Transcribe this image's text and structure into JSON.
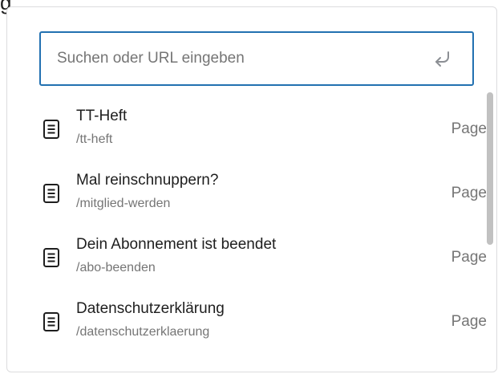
{
  "page_fragment_text": "g",
  "search": {
    "placeholder": "Suchen oder URL eingeben",
    "value": "",
    "submit_icon": "enter-return-icon"
  },
  "results": [
    {
      "title": "TT-Heft",
      "url": "/tt-heft",
      "type": "Page",
      "icon": "document-page-icon"
    },
    {
      "title": "Mal reinschnuppern?",
      "url": "/mitglied-werden",
      "type": "Page",
      "icon": "document-page-icon"
    },
    {
      "title": "Dein Abonnement ist beendet",
      "url": "/abo-beenden",
      "type": "Page",
      "icon": "document-page-icon"
    },
    {
      "title": "Datenschutzerklärung",
      "url": "/datenschutzerklaerung",
      "type": "Page",
      "icon": "document-page-icon"
    }
  ],
  "colors": {
    "accent_focus": "#2271b1",
    "text_primary": "#1e1e1e",
    "text_secondary": "#757575",
    "scrollbar_thumb": "#c1c1c1"
  }
}
